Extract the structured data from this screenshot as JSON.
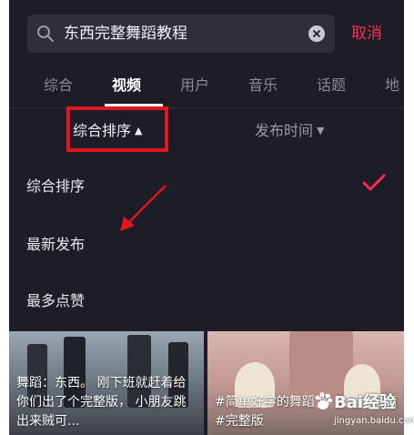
{
  "search": {
    "query": "东西完整舞蹈教程",
    "cancel_label": "取消"
  },
  "tabs": [
    {
      "label": "综合"
    },
    {
      "label": "视频",
      "active": true
    },
    {
      "label": "用户"
    },
    {
      "label": "音乐"
    },
    {
      "label": "话题"
    },
    {
      "label": "地"
    }
  ],
  "sort": {
    "main_label": "综合排序",
    "main_arrow": "▲",
    "time_label": "发布时间",
    "time_arrow": "▼"
  },
  "options": [
    {
      "label": "综合排序",
      "selected": true
    },
    {
      "label": "最新发布",
      "selected": false
    },
    {
      "label": "最多点赞",
      "selected": false
    }
  ],
  "videos": [
    {
      "caption": "舞蹈：东西。   刚下班就赶着给你们出了个完整版， 小朋友跳出来贼可..."
    },
    {
      "caption": "#简单好学的舞蹈 解 #舞蹈东西 #完整版"
    }
  ],
  "watermark": {
    "title": "Bai经验",
    "subtitle": "jingyan.baidu.com"
  },
  "colors": {
    "background": "#1c1d27",
    "accent": "#fe2c55",
    "highlight_box": "#e2141e"
  }
}
